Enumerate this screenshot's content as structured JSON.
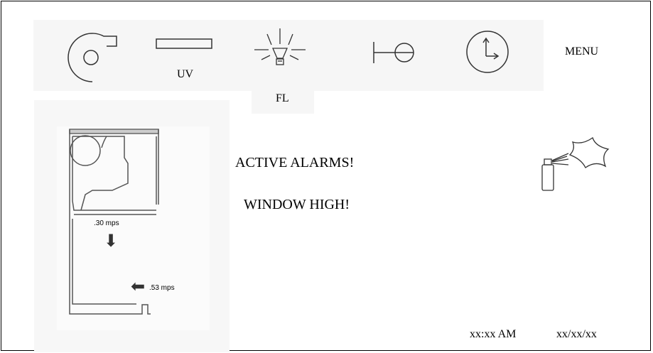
{
  "toolbar": {
    "uv_label": "UV",
    "fl_label": "FL",
    "menu_label": "MENU",
    "icons": [
      "blower-icon",
      "uv-lamp-icon",
      "light-bulb-icon",
      "damper-icon",
      "clock-icon"
    ]
  },
  "alerts": {
    "line1": "ACTIVE ALARMS!",
    "line2": "WINDOW HIGH!"
  },
  "airflow": {
    "downflow": ".30 mps",
    "inflow": ".53 mps"
  },
  "status": {
    "time": "xx:xx AM",
    "date": "xx/xx/xx"
  },
  "colors": {
    "toolbar_bg": "#f6f6f6",
    "border": "#000000"
  }
}
